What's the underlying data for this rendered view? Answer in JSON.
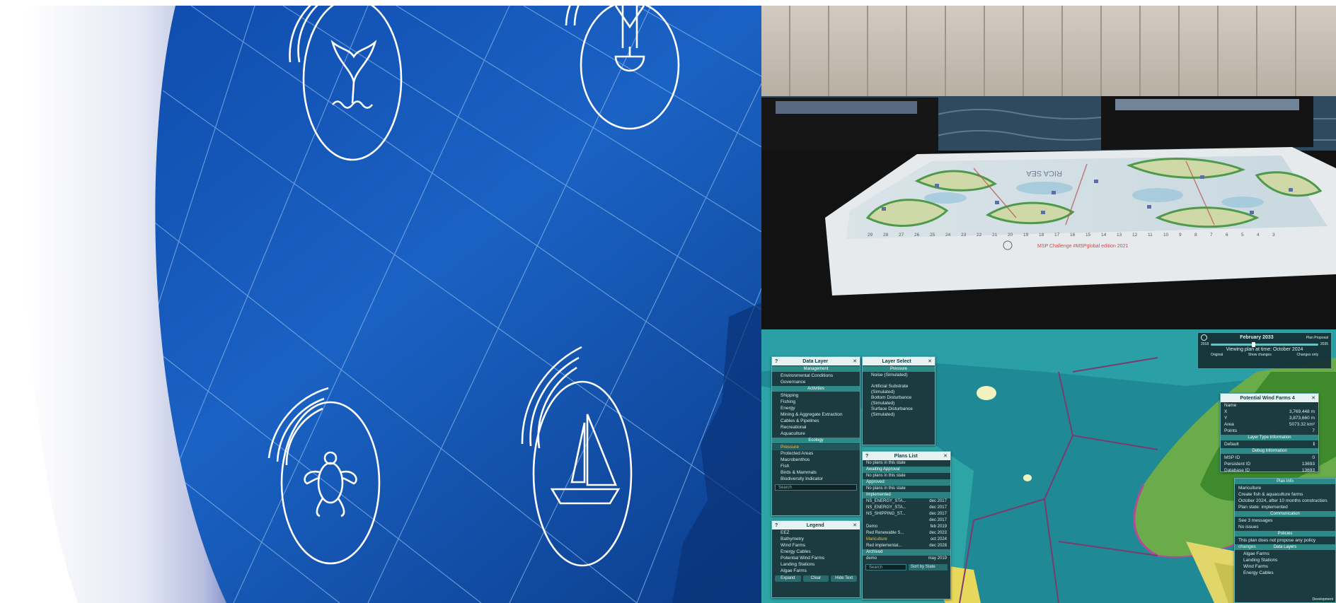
{
  "game": {
    "timeline": {
      "date": "February 2033",
      "viewing": "Viewing plan at time: October 2024",
      "range_start": "2018",
      "range_end": "2035",
      "buttons": [
        "Original",
        "Show changes",
        "Changes only"
      ],
      "corner": "Plan Proposal"
    },
    "data_layer": {
      "title": "Data Layer",
      "sections": [
        {
          "name": "Management",
          "items": [
            "Environmental Conditions",
            "Governance"
          ]
        },
        {
          "name": "Activities",
          "items": [
            "Shipping",
            "Fishing",
            "Energy",
            "Mining & Aggregate Extraction",
            "Cables & Pipelines",
            "Recreational",
            "Aquaculture"
          ]
        },
        {
          "name": "Ecology",
          "items": [
            "Pressure",
            "Protected Areas",
            "Macrobenthos",
            "Fish",
            "Birds & Mammals",
            "Biodiversity Indicator"
          ]
        }
      ],
      "search": "Search"
    },
    "layer_select": {
      "title": "Layer Select",
      "section": "Pressure",
      "items": [
        "Noise (Simulated)",
        "Artificial Substrate (Simulated)",
        "Bottom Disturbance (Simulated)",
        "Surface Disturbance (Simulated)"
      ]
    },
    "legend": {
      "title": "Legend",
      "items": [
        "EEZ",
        "Bathymetry",
        "Wind Farms",
        "Energy Cables",
        "Potential Wind Farms",
        "Landing Stations",
        "Algae Farms"
      ],
      "buttons": [
        "Expand",
        "Clear",
        "Hide Text"
      ]
    },
    "plans_list": {
      "title": "Plans List",
      "rows": [
        {
          "kind": "note",
          "text": "No plans in this state"
        },
        {
          "kind": "state",
          "text": "Awaiting Approval"
        },
        {
          "kind": "note",
          "text": "No plans in this state"
        },
        {
          "kind": "state",
          "text": "Approved"
        },
        {
          "kind": "note",
          "text": "No plans in this state"
        },
        {
          "kind": "state",
          "text": "Implemented"
        },
        {
          "kind": "plan",
          "text": "NS_ENERGY_STA...",
          "date": "dec 2017"
        },
        {
          "kind": "plan",
          "text": "NS_ENERGY_STA...",
          "date": "dec 2017"
        },
        {
          "kind": "plan",
          "text": "NS_SHIPPING_ST...",
          "date": "dec 2017"
        },
        {
          "kind": "plan",
          "text": "",
          "date": "dec 2017"
        },
        {
          "kind": "plan",
          "text": "Demo",
          "date": "feb 2019"
        },
        {
          "kind": "plan",
          "text": "Red Renewable S...",
          "date": "dec 2023"
        },
        {
          "kind": "plan",
          "text": "Mariculture",
          "date": "oct 2024"
        },
        {
          "kind": "plan",
          "text": "Red implementat...",
          "date": "dec 2028"
        },
        {
          "kind": "state",
          "text": "Archived"
        },
        {
          "kind": "plan",
          "text": "demo",
          "date": "may 2019"
        }
      ],
      "search": "Search",
      "sort": "Sort by State"
    },
    "wind_farm": {
      "title": "Potential Wind Farms 4",
      "fields": [
        {
          "k": "Name",
          "v": ""
        },
        {
          "k": "X",
          "v": "3,769,448 m"
        },
        {
          "k": "Y",
          "v": "3,873,660 m"
        },
        {
          "k": "Area",
          "v": "5073.32 km²"
        },
        {
          "k": "Points",
          "v": "7"
        }
      ],
      "layer_type": "Layer Type Information",
      "default": "Default",
      "debug": "Debug Information",
      "debug_fields": [
        {
          "k": "MSP ID",
          "v": "0"
        },
        {
          "k": "Persistent ID",
          "v": "13693"
        },
        {
          "k": "Database ID",
          "v": "13693"
        }
      ]
    },
    "plan_info": {
      "title": "Plan Info",
      "name": "Mariculture",
      "desc": "Create fish & aquaculture farms",
      "lines": [
        "October 2024, after 10 months construction.",
        "Plan state: implemented"
      ],
      "communication": "Communication",
      "comm_lines": [
        "See 3 messages",
        "No issues"
      ],
      "policies": "Policies",
      "policy_text": "This plan does not propose any policy changes",
      "data_layers": "Data Layers",
      "layers": [
        "Algae Farms",
        "Landing Stations",
        "Wind Farms",
        "Energy Cables"
      ],
      "footer": "Development"
    }
  },
  "board": {
    "caption": "MSP Challenge #MSPglobal edition 2021",
    "sea_name": "RICA SEA",
    "ruler_numbers": [
      "29",
      "28",
      "27",
      "26",
      "25",
      "24",
      "23",
      "22",
      "21",
      "20",
      "19",
      "18",
      "17",
      "16",
      "15",
      "14",
      "13",
      "12",
      "11",
      "10",
      "9",
      "8",
      "7",
      "6",
      "5",
      "4",
      "3"
    ]
  },
  "colors": {
    "poster_blue": "#1556b0",
    "poster_deep": "#0d3f8f",
    "game_ocean": "#1b7e8c",
    "panel_bg": "#1c3b40",
    "panel_accent": "#2e8a86"
  }
}
